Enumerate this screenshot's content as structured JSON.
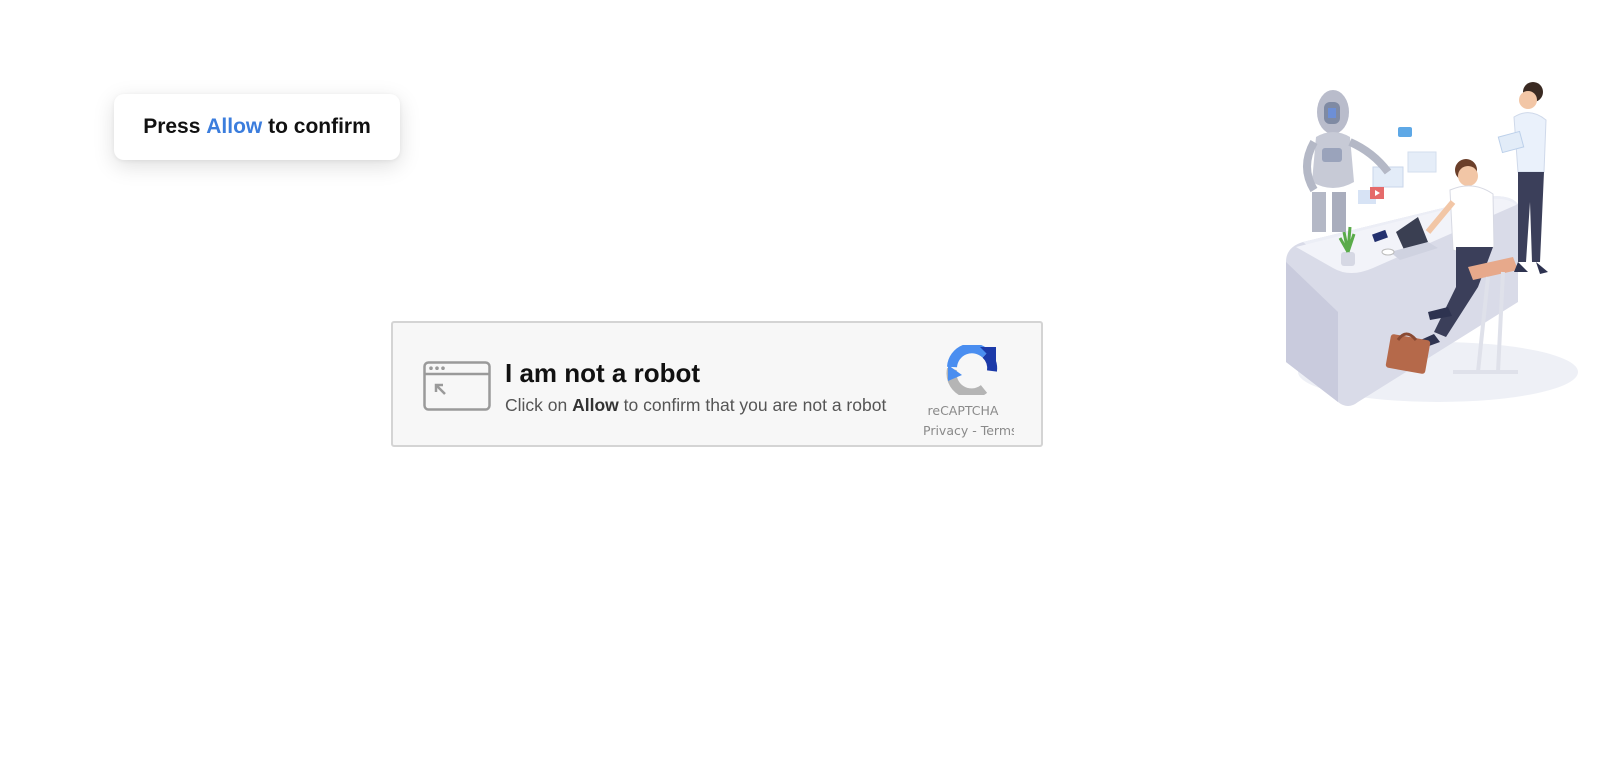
{
  "toast": {
    "prefix": "Press",
    "highlight": "Allow",
    "suffix": "to confirm",
    "accent_color": "#3b7ddd"
  },
  "captcha": {
    "icon": "browser-window-cursor-icon",
    "title": "I am not a robot",
    "subtitle_prefix": "Click on",
    "subtitle_bold": "Allow",
    "subtitle_suffix": "to confirm that you are not a robot",
    "logo_icon": "recaptcha-logo-icon",
    "brand": "reCAPTCHA",
    "links": "Privacy - Terms"
  },
  "illustration": {
    "icon": "office-robot-illustration"
  }
}
